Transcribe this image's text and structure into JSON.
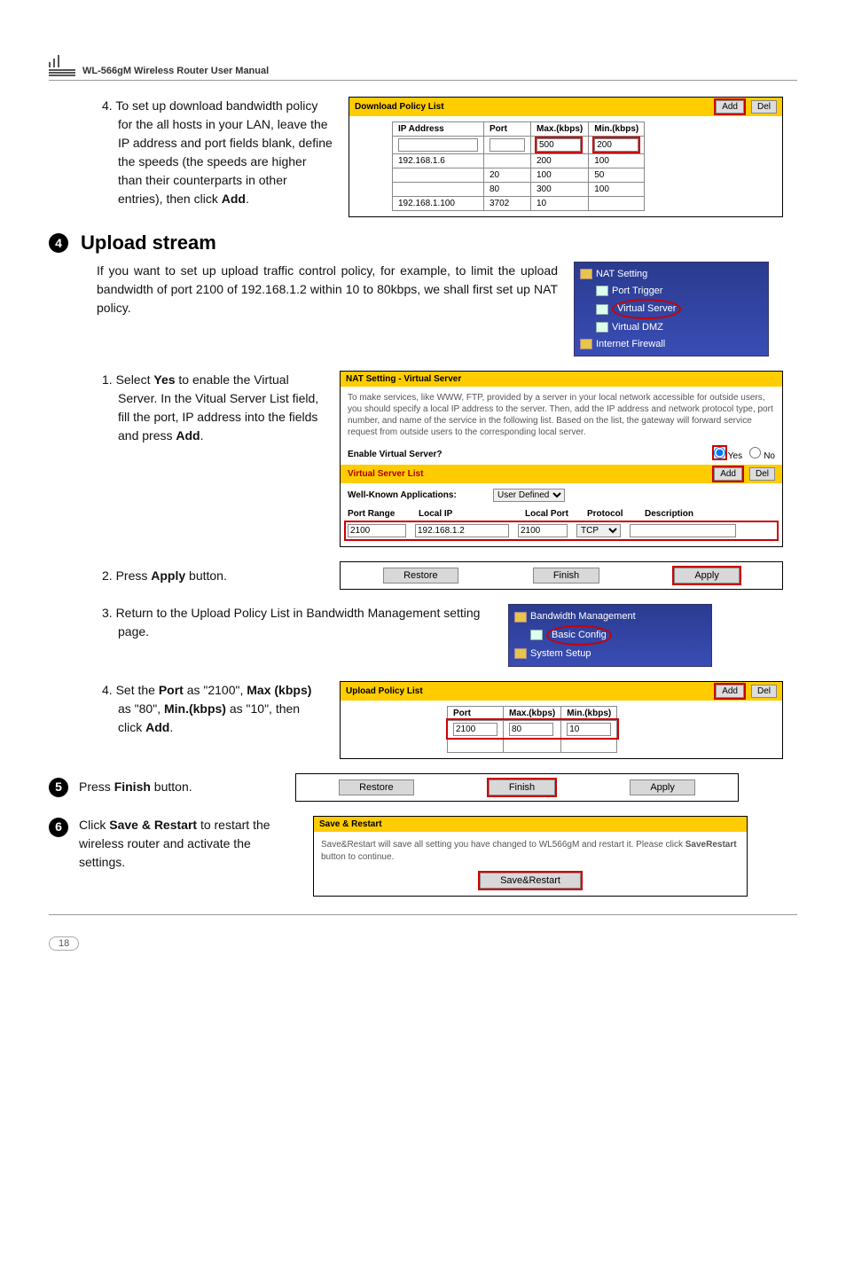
{
  "header": {
    "title": "WL-566gM Wireless Router User Manual"
  },
  "step_dl4": {
    "text_prefix": "4. To set up download bandwidth policy for the all hosts in your LAN, leave the IP address and port fields blank, define the speeds (the speeds are higher than their counterparts in other entries), then click ",
    "bold": "Add",
    "suffix": "."
  },
  "dl_panel": {
    "title": "Download Policy List",
    "add": "Add",
    "del": "Del",
    "cols": [
      "IP Address",
      "Port",
      "Max.(kbps)",
      "Min.(kbps)"
    ],
    "input_row": [
      "",
      "",
      "500",
      "200"
    ],
    "rows": [
      [
        "192.168.1.6",
        "",
        "200",
        "100"
      ],
      [
        "",
        "20",
        "100",
        "50"
      ],
      [
        "",
        "80",
        "300",
        "100"
      ],
      [
        "192.168.1.100",
        "3702",
        "10",
        ""
      ]
    ]
  },
  "section4": {
    "num": "4",
    "title": "Upload stream"
  },
  "upload_intro": "If you want to set up upload traffic control policy, for example, to limit the upload bandwidth of port 2100 of 192.168.1.2 within 10 to 80kbps, we shall first set up NAT policy.",
  "nav1": {
    "items": [
      {
        "icon": "folder",
        "label": "NAT Setting",
        "indent": false,
        "hl": false
      },
      {
        "icon": "page",
        "label": "Port Trigger",
        "indent": true,
        "hl": false
      },
      {
        "icon": "page",
        "label": "Virtual Server",
        "indent": true,
        "hl": true
      },
      {
        "icon": "page",
        "label": "Virtual DMZ",
        "indent": true,
        "hl": false
      },
      {
        "icon": "folder",
        "label": "Internet Firewall",
        "indent": false,
        "hl": false
      }
    ]
  },
  "step_u1": {
    "pre": "1. Select ",
    "b1": "Yes",
    "mid": " to enable the Virtual Server. In the Vitual Server List field, fill the port, IP address into the fields and press ",
    "b2": "Add",
    "post": "."
  },
  "nat_panel": {
    "title": "NAT Setting - Virtual Server",
    "intro": "To make services, like WWW, FTP, provided by a server in your local network accessible for outside users, you should specify a local IP address to the server. Then, add the IP address and network protocol type, port number, and name of the service in the following list. Based on the list, the gateway will forward service request from outside users to the corresponding local server.",
    "enable_label": "Enable Virtual Server?",
    "yes": "Yes",
    "no": "No",
    "list_title": "Virtual Server List",
    "add": "Add",
    "del": "Del",
    "wk_label": "Well-Known Applications:",
    "wk_val": "User Defined",
    "cols": [
      "Port Range",
      "Local IP",
      "Local Port",
      "Protocol",
      "Description"
    ],
    "row": [
      "2100",
      "192.168.1.2",
      "2100",
      "TCP",
      ""
    ]
  },
  "step_u2": {
    "pre": "2. Press ",
    "b": "Apply",
    "post": " button."
  },
  "actions": {
    "restore": "Restore",
    "finish": "Finish",
    "apply": "Apply"
  },
  "step_u3": "3. Return to the Upload Policy List in Bandwidth Management setting page.",
  "nav2": {
    "items": [
      {
        "icon": "folder",
        "label": "Bandwidth Management",
        "indent": false,
        "hl": false
      },
      {
        "icon": "page",
        "label": "Basic Config",
        "indent": true,
        "hl": true
      },
      {
        "icon": "folder",
        "label": "System Setup",
        "indent": false,
        "hl": false
      }
    ]
  },
  "step_u4": {
    "pre": "4. Set the ",
    "b1": "Port",
    "t1": " as \"2100\", ",
    "b2": "Max (kbps)",
    "t2": " as \"80\", ",
    "b3": "Min.(kbps)",
    "t3": " as \"10\", then click ",
    "b4": "Add",
    "post": "."
  },
  "ul_panel": {
    "title": "Upload Policy List",
    "add": "Add",
    "del": "Del",
    "cols": [
      "Port",
      "Max.(kbps)",
      "Min.(kbps)"
    ],
    "row": [
      "2100",
      "80",
      "10"
    ]
  },
  "section5": {
    "num": "5",
    "pre": "Press ",
    "b": "Finish",
    "post": " button."
  },
  "section6": {
    "num": "6",
    "pre": "Click ",
    "b": "Save & Restart",
    "post": " to restart the wireless router and activate the settings."
  },
  "sr_panel": {
    "title": "Save & Restart",
    "text_pre": "Save&Restart will save all setting you have changed to WL566gM and restart it. Please click ",
    "text_b": "SaveRestart",
    "text_post": " button to continue.",
    "btn": "Save&Restart"
  },
  "page_number": "18"
}
